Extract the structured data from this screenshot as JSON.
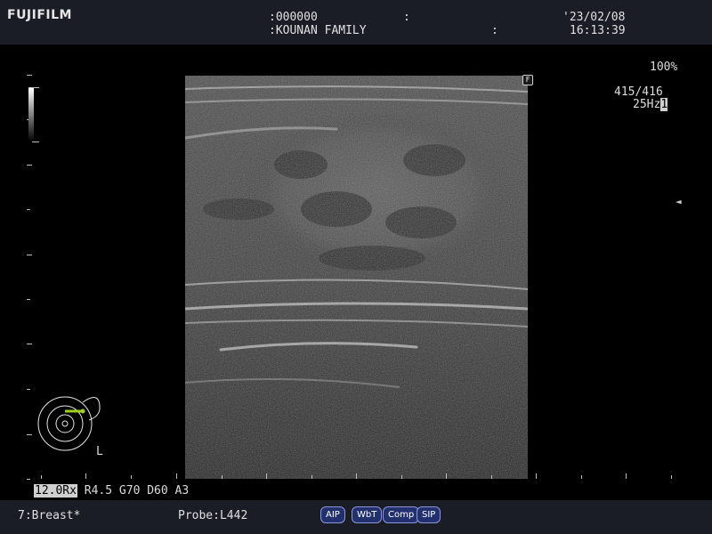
{
  "header": {
    "logo": "FUJIFILM",
    "patient_id": ":000000",
    "id_sep": ":",
    "patient_name": ":KOUNAN FAMILY",
    "name_sep": ":",
    "date": "'23/02/08",
    "time": "16:13:39"
  },
  "display": {
    "zoom": "100%",
    "frame_counter": "415/416",
    "frame_rate": "25Hz",
    "frame_rate_marker": "1",
    "orientation_mark": "F",
    "focus_marker": "◄",
    "body_mark_side": "L"
  },
  "parameters": {
    "frequency": "12.0Rx",
    "rest": " R4.5 G70 D60 A3"
  },
  "footer": {
    "preset": "7:Breast*",
    "probe": "Probe:L442",
    "mode_buttons": [
      "AIP",
      "WbT",
      "Comp",
      "SIP"
    ]
  },
  "colors": {
    "header_bg": "#1a1d26",
    "button_bg": "#23306e",
    "button_border": "#8c96d8",
    "bodymark_probe": "#a0d020"
  }
}
